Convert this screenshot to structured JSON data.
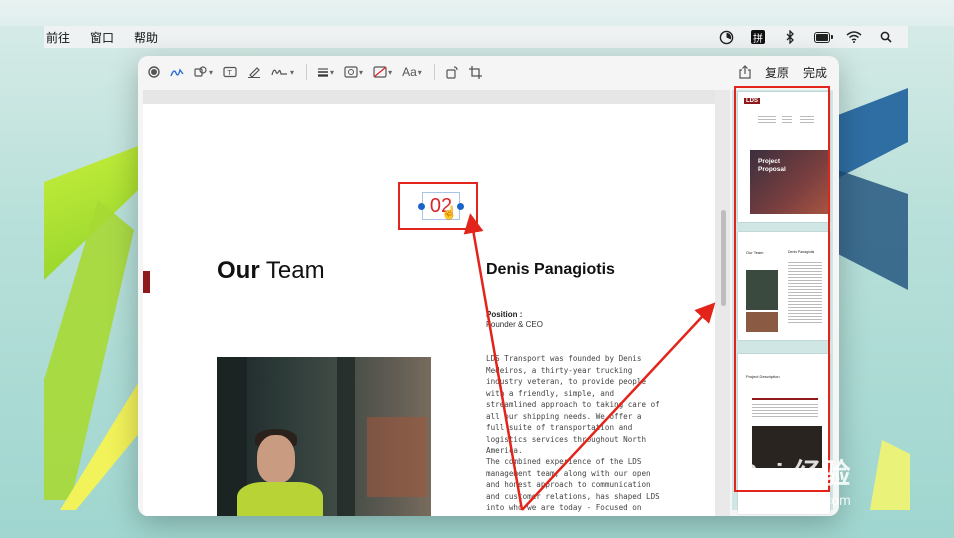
{
  "menubar": {
    "items": [
      "前往",
      "窗口",
      "帮助"
    ],
    "ime_label": "拼"
  },
  "toolbar": {
    "font_label": "Aa",
    "revert_label": "复原",
    "done_label": "完成"
  },
  "document": {
    "page_number": "02",
    "heading_bold": "Our",
    "heading_regular": " Team",
    "person_name": "Denis Panagiotis",
    "position_label": "Position    :",
    "position_value": "Founder & CEO",
    "para1": "LDS Transport was founded by Denis Medeiros, a thirty-year trucking industry veteran, to provide people with a friendly, simple, and streamlined approach to taking care of all our shipping needs. We offer a full suite of transportation and logistics services throughout North America.",
    "para2": "The combined experience of the LDS management team, along with our open and honest approach to communication and customer relations, has shaped LDS into who we are today - Focused on"
  },
  "thumbnails": {
    "logo": "LDS",
    "cover_title_line1": "Project",
    "cover_title_line2": "Proposal",
    "page2_heading": "Our Team",
    "page2_name": "Denis Panagiotis",
    "page3_heading": "Project Description"
  },
  "watermark": {
    "main": "Bai 经验",
    "sub": "jingyan.baidu.com"
  },
  "colors": {
    "annotation_red": "#e3241b",
    "brand_maroon": "#8f1a1c",
    "selection_blue": "#1a64c8"
  }
}
